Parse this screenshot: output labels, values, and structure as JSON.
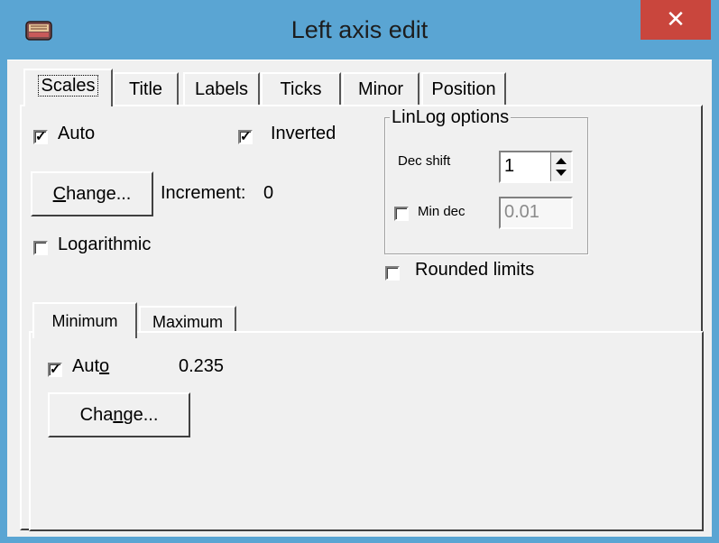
{
  "window": {
    "title": "Left axis edit",
    "close_label": "✕"
  },
  "tabs": [
    {
      "label": "Scales"
    },
    {
      "label": "Title"
    },
    {
      "label": "Labels"
    },
    {
      "label": "Ticks"
    },
    {
      "label": "Minor"
    },
    {
      "label": "Position"
    }
  ],
  "scales": {
    "auto_label": "Auto",
    "auto_checked": true,
    "inverted_label": "Inverted",
    "inverted_checked": true,
    "change_button": "Change...",
    "increment_label": "Increment:",
    "increment_value": "0",
    "logarithmic_label": "Logarithmic",
    "logarithmic_checked": false,
    "rounded_limits_label": "Rounded limits",
    "rounded_limits_checked": false
  },
  "linlog": {
    "legend": "LinLog options",
    "dec_shift_label": "Dec shift",
    "dec_shift_value": "1",
    "min_dec_label": "Min dec",
    "min_dec_checked": false,
    "min_dec_value": "0.01"
  },
  "sub_tabs": [
    {
      "label": "Minimum"
    },
    {
      "label": "Maximum"
    }
  ],
  "minimum": {
    "auto_label_prefix": "Aut",
    "auto_label_underlined": "o",
    "auto_checked": true,
    "value": "0.235",
    "change_prefix": "Cha",
    "change_underlined": "n",
    "change_suffix": "ge..."
  },
  "change_underlined_char": "C",
  "change_rest": "hange..."
}
